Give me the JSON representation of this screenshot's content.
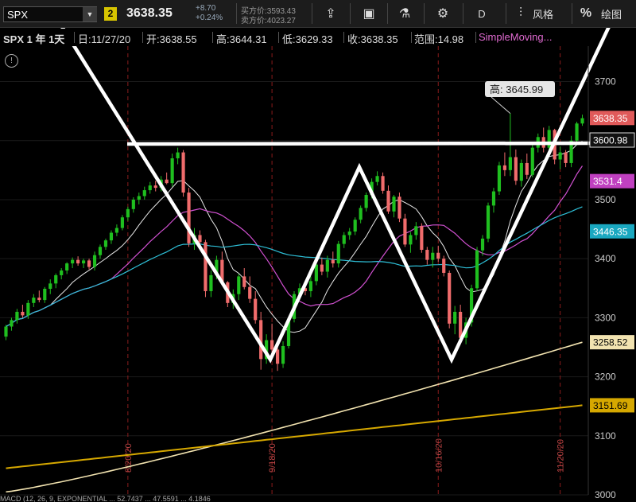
{
  "toolbar": {
    "symbol": "SPX",
    "link_number": "2",
    "last_price": "3638.35",
    "change": "+8.70",
    "change_pct": "+0.24%",
    "bid": "买方价:3593.43",
    "ask": "卖方价:4023.27",
    "period_label": "D",
    "style_label": "风格",
    "draw_label": "绘图"
  },
  "infobar": {
    "title": "SPX 1 年 1天",
    "date": "日:11/27/20",
    "open": "开:3638.55",
    "high": "高:3644.31",
    "low": "低:3629.33",
    "close": "收:3638.35",
    "range": "范围:14.98",
    "study": "SimpleMoving..."
  },
  "macd_label": "MACD (12, 26, 9, EXPONENTIAL ... 52.7437 ... 47.5591 ... 4.1846",
  "colors": {
    "up": "#1fbf1f",
    "down": "#f06c6c",
    "sma_white": "#e8e8e8",
    "sma_pink": "#d050d0",
    "sma_cyan": "#2ec0d8",
    "sma_cream": "#f2e3b0",
    "sma_gold": "#d6a800"
  },
  "chart_data": {
    "type": "candlestick",
    "ylim": [
      3000,
      3760
    ],
    "yticks": [
      3000,
      3100,
      3200,
      3300,
      3400,
      3500,
      3600,
      3700
    ],
    "date_markers": [
      "8/20/20",
      "9/18/20",
      "10/16/20",
      "11/20/20"
    ],
    "price_tags": [
      {
        "label": "3638.35",
        "value": 3638.35,
        "kind": "last"
      },
      {
        "label": "3600.98",
        "value": 3600.98,
        "kind": "white"
      },
      {
        "label": "3531.4",
        "value": 3531.4,
        "kind": "pink"
      },
      {
        "label": "3446.35",
        "value": 3446.35,
        "kind": "cyan"
      },
      {
        "label": "3258.52",
        "value": 3258.52,
        "kind": "cream"
      },
      {
        "label": "3151.69",
        "value": 3151.69,
        "kind": "gold"
      }
    ],
    "high_annotation": {
      "label": "高: 3645.99",
      "value": 3645.99
    },
    "candles": [
      [
        3268,
        3288,
        3262,
        3285
      ],
      [
        3285,
        3300,
        3278,
        3296
      ],
      [
        3296,
        3315,
        3290,
        3310
      ],
      [
        3310,
        3322,
        3300,
        3304
      ],
      [
        3304,
        3330,
        3298,
        3325
      ],
      [
        3325,
        3340,
        3318,
        3334
      ],
      [
        3334,
        3346,
        3326,
        3330
      ],
      [
        3330,
        3352,
        3325,
        3349
      ],
      [
        3349,
        3365,
        3340,
        3358
      ],
      [
        3358,
        3375,
        3350,
        3372
      ],
      [
        3372,
        3384,
        3365,
        3380
      ],
      [
        3380,
        3394,
        3374,
        3392
      ],
      [
        3392,
        3402,
        3384,
        3398
      ],
      [
        3398,
        3404,
        3388,
        3392
      ],
      [
        3392,
        3400,
        3384,
        3397
      ],
      [
        3397,
        3400,
        3382,
        3386
      ],
      [
        3386,
        3412,
        3380,
        3406
      ],
      [
        3406,
        3424,
        3400,
        3420
      ],
      [
        3420,
        3434,
        3415,
        3431
      ],
      [
        3431,
        3448,
        3425,
        3444
      ],
      [
        3444,
        3458,
        3438,
        3452
      ],
      [
        3452,
        3474,
        3448,
        3470
      ],
      [
        3470,
        3488,
        3464,
        3484
      ],
      [
        3484,
        3504,
        3478,
        3500
      ],
      [
        3500,
        3512,
        3492,
        3506
      ],
      [
        3506,
        3522,
        3500,
        3516
      ],
      [
        3516,
        3530,
        3510,
        3524
      ],
      [
        3524,
        3532,
        3514,
        3520
      ],
      [
        3520,
        3540,
        3514,
        3534
      ],
      [
        3534,
        3546,
        3526,
        3528
      ],
      [
        3528,
        3578,
        3522,
        3570
      ],
      [
        3570,
        3588,
        3560,
        3580
      ],
      [
        3580,
        3584,
        3505,
        3512
      ],
      [
        3512,
        3520,
        3420,
        3426
      ],
      [
        3426,
        3452,
        3415,
        3440
      ],
      [
        3440,
        3448,
        3420,
        3428
      ],
      [
        3428,
        3432,
        3335,
        3345
      ],
      [
        3345,
        3380,
        3335,
        3372
      ],
      [
        3372,
        3405,
        3365,
        3398
      ],
      [
        3398,
        3412,
        3355,
        3360
      ],
      [
        3360,
        3362,
        3318,
        3325
      ],
      [
        3325,
        3348,
        3315,
        3340
      ],
      [
        3340,
        3374,
        3330,
        3370
      ],
      [
        3370,
        3384,
        3348,
        3352
      ],
      [
        3352,
        3370,
        3325,
        3332
      ],
      [
        3332,
        3345,
        3290,
        3296
      ],
      [
        3296,
        3310,
        3212,
        3230
      ],
      [
        3230,
        3272,
        3222,
        3262
      ],
      [
        3262,
        3290,
        3235,
        3246
      ],
      [
        3246,
        3252,
        3210,
        3222
      ],
      [
        3222,
        3260,
        3215,
        3252
      ],
      [
        3252,
        3302,
        3248,
        3298
      ],
      [
        3298,
        3345,
        3292,
        3340
      ],
      [
        3340,
        3358,
        3330,
        3350
      ],
      [
        3350,
        3362,
        3338,
        3345
      ],
      [
        3345,
        3370,
        3335,
        3362
      ],
      [
        3362,
        3395,
        3355,
        3390
      ],
      [
        3390,
        3402,
        3372,
        3378
      ],
      [
        3378,
        3405,
        3368,
        3398
      ],
      [
        3398,
        3412,
        3385,
        3392
      ],
      [
        3392,
        3430,
        3385,
        3425
      ],
      [
        3425,
        3445,
        3418,
        3440
      ],
      [
        3440,
        3452,
        3432,
        3446
      ],
      [
        3446,
        3470,
        3440,
        3466
      ],
      [
        3466,
        3490,
        3460,
        3486
      ],
      [
        3486,
        3512,
        3480,
        3508
      ],
      [
        3508,
        3536,
        3502,
        3530
      ],
      [
        3530,
        3548,
        3524,
        3540
      ],
      [
        3540,
        3546,
        3510,
        3515
      ],
      [
        3515,
        3524,
        3476,
        3480
      ],
      [
        3480,
        3508,
        3470,
        3505
      ],
      [
        3505,
        3512,
        3462,
        3468
      ],
      [
        3468,
        3476,
        3420,
        3424
      ],
      [
        3424,
        3445,
        3410,
        3440
      ],
      [
        3440,
        3462,
        3432,
        3455
      ],
      [
        3455,
        3460,
        3410,
        3415
      ],
      [
        3415,
        3420,
        3390,
        3398
      ],
      [
        3398,
        3420,
        3385,
        3410
      ],
      [
        3410,
        3422,
        3395,
        3400
      ],
      [
        3400,
        3405,
        3370,
        3376
      ],
      [
        3376,
        3380,
        3282,
        3290
      ],
      [
        3290,
        3320,
        3272,
        3310
      ],
      [
        3310,
        3322,
        3258,
        3266
      ],
      [
        3266,
        3300,
        3255,
        3292
      ],
      [
        3292,
        3356,
        3285,
        3350
      ],
      [
        3350,
        3420,
        3345,
        3414
      ],
      [
        3414,
        3440,
        3405,
        3434
      ],
      [
        3434,
        3495,
        3428,
        3490
      ],
      [
        3490,
        3520,
        3478,
        3514
      ],
      [
        3514,
        3564,
        3508,
        3558
      ],
      [
        3558,
        3580,
        3540,
        3550
      ],
      [
        3550,
        3646,
        3540,
        3572
      ],
      [
        3572,
        3585,
        3525,
        3532
      ],
      [
        3532,
        3568,
        3522,
        3562
      ],
      [
        3562,
        3578,
        3535,
        3542
      ],
      [
        3542,
        3595,
        3538,
        3588
      ],
      [
        3588,
        3612,
        3580,
        3606
      ],
      [
        3606,
        3622,
        3580,
        3588
      ],
      [
        3588,
        3625,
        3582,
        3618
      ],
      [
        3618,
        3620,
        3560,
        3568
      ],
      [
        3568,
        3590,
        3552,
        3580
      ],
      [
        3580,
        3584,
        3555,
        3562
      ],
      [
        3562,
        3608,
        3555,
        3600
      ],
      [
        3600,
        3632,
        3592,
        3629
      ],
      [
        3629,
        3644,
        3625,
        3638
      ]
    ]
  }
}
